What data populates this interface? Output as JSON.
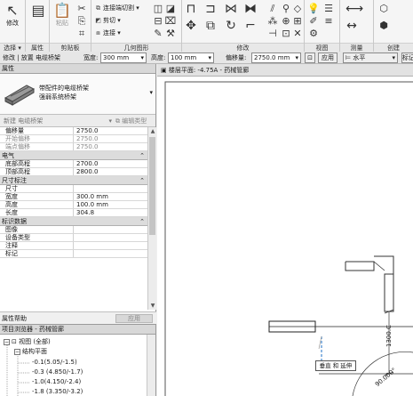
{
  "ribbon": {
    "modify_label": "修改",
    "select_label": "选择",
    "properties_label": "属性",
    "clipboard_label": "剪贴板",
    "paste_label": "粘贴",
    "geometry_label": "几何图形",
    "join_label": "连接端切割",
    "cut_label": "剪切",
    "connect_label": "连接",
    "modify_panel_label": "修改",
    "view_label": "视图",
    "measure_label": "测量",
    "create_label": "创建"
  },
  "options_bar": {
    "context": "修改 | 放置 电缆桥架",
    "width_label": "宽度:",
    "width_value": "300 mm",
    "height_label": "高度:",
    "height_value": "100 mm",
    "offset_label": "偏移量:",
    "offset_value": "2750.0 mm",
    "apply_label": "应用",
    "horizontal_label": "水平",
    "extra_label": "标记"
  },
  "properties": {
    "title": "属性",
    "type_name_1": "带配件的电缆桥架",
    "type_name_2": "强弱系统桥架",
    "filter_value": "新建 电缆桥架",
    "edit_type_label": "编辑类型",
    "rows_top": [
      {
        "key": "偏移量",
        "value": "2750.0",
        "dim": false
      },
      {
        "key": "开始偏移",
        "value": "2750.0",
        "dim": true
      },
      {
        "key": "端点偏移",
        "value": "2750.0",
        "dim": true
      }
    ],
    "section_electrical": "电气",
    "rows_electrical": [
      {
        "key": "底部高程",
        "value": "2700.0"
      },
      {
        "key": "顶部高程",
        "value": "2800.0"
      }
    ],
    "section_dimensions": "尺寸标注",
    "rows_dimensions": [
      {
        "key": "尺寸",
        "value": ""
      },
      {
        "key": "宽度",
        "value": "300.0 mm"
      },
      {
        "key": "高度",
        "value": "100.0 mm"
      },
      {
        "key": "长度",
        "value": "304.8"
      }
    ],
    "section_identity": "标识数据",
    "rows_identity": [
      {
        "key": "图像",
        "value": ""
      },
      {
        "key": "设备类型",
        "value": ""
      },
      {
        "key": "注释",
        "value": ""
      },
      {
        "key": "标记",
        "value": ""
      }
    ],
    "help_label": "属性帮助",
    "apply_label": "应用"
  },
  "browser": {
    "title": "项目浏览器 - 药械管廊",
    "views_label": "视图 (全部)",
    "struct_label": "结构平面",
    "items": [
      "-0.1(5.05/-1.5)",
      "-0.3  (4.850/-1.7)",
      "-1.0(4.150/-2.4)",
      "-1.8  (3.350/-3.2)"
    ]
  },
  "view": {
    "tab_title": "楼层平面: -4.75A - 药械管廊",
    "tooltip": "垂直 和 延伸",
    "dim_vertical": "1300.C",
    "dim_angle": "90.000°"
  },
  "colors": {
    "accent": "#2b5797",
    "dash_blue": "#1e6fc4"
  }
}
